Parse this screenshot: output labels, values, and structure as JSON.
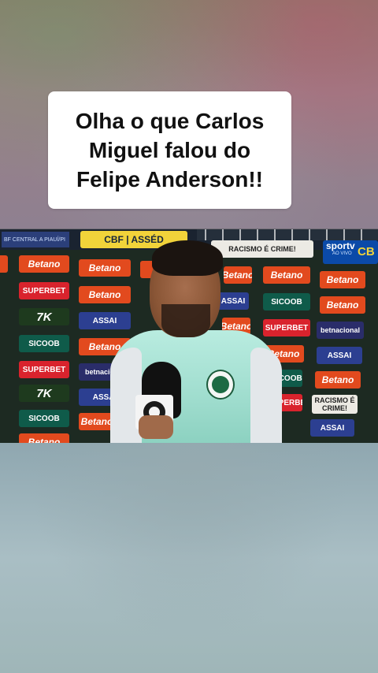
{
  "caption": {
    "line1": "Olha o que Carlos",
    "line2": "Miguel falou do",
    "line3": "Felipe Anderson!!"
  },
  "broadcast": {
    "channel": "sportv",
    "channel_sub": "AO VIVO",
    "corner_logo": "CB",
    "mini_banner": "BF CENTRAL A PIAUÍ/PI"
  },
  "sponsors": {
    "betano": "Betano",
    "superbet": "SUPERBET",
    "assai": "ASSAI",
    "sicoob": "SICOOB",
    "k7": "7K",
    "betnacional": "betnacional",
    "racismo": "RACISMO É CRIME!",
    "racismo_stack": "RACISMO É CRIME!",
    "cbf": "CBF | ASSÉD"
  },
  "colors": {
    "betano": "#e24a1e",
    "superbet": "#d9232d",
    "assai": "#2c3f91",
    "sicoob": "#0f5b4a",
    "jersey": "#9edccd",
    "palmeiras": "#1c6a43"
  },
  "icons": {
    "mic": "microphone-icon",
    "globo": "globo-logo-icon",
    "crest": "palmeiras-crest-icon"
  }
}
